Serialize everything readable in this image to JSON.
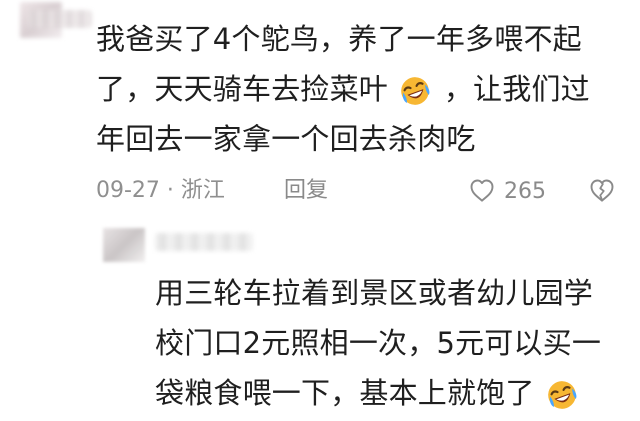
{
  "comment": {
    "lines": [
      "我爸买了4个鸵鸟，养了一年多喂不起",
      "了，天天骑车去捡菜叶",
      "，让我们过",
      "年回去一家拿一个回去杀肉吃"
    ],
    "meta": {
      "date": "09-27 · 浙江",
      "reply_label": "回复",
      "like_count": "265"
    }
  },
  "reply": {
    "lines": [
      "用三轮车拉着到景区或者幼儿园学",
      "校门口2元照相一次，5元可以买一",
      "袋粮食喂一下，基本上就饱了"
    ]
  },
  "icons": {
    "emoji_laugh": "rolling-on-the-floor-laughing-icon",
    "like": "heart-outline-icon",
    "dislike": "broken-heart-outline-icon"
  },
  "colors": {
    "text": "#1f1f1f",
    "meta": "#8f8f8f",
    "emoji_face": "#f7b733",
    "emoji_tear": "#49a6ff",
    "emoji_mouth": "#7a2c12"
  }
}
